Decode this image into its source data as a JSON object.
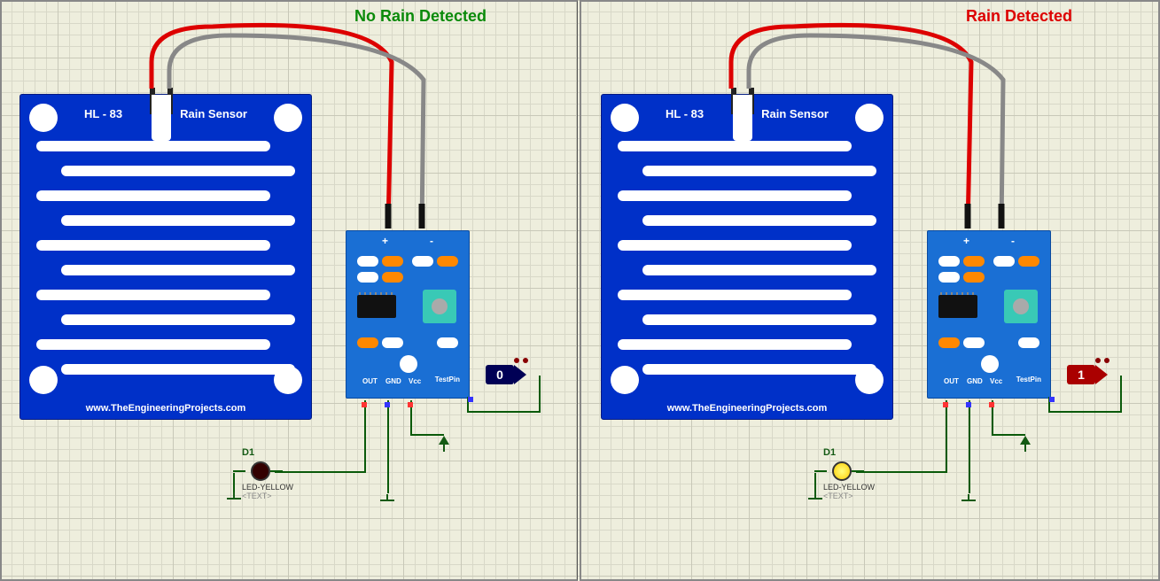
{
  "panels": {
    "left": {
      "status": "No Rain Detected",
      "status_color": "#0a8a0a",
      "probe_value": "0",
      "led_state": "off"
    },
    "right": {
      "status": "Rain Detected",
      "status_color": "#d00000",
      "probe_value": "1",
      "led_state": "on"
    }
  },
  "rain_board": {
    "model": "HL - 83",
    "title": "Rain Sensor",
    "url": "www.TheEngineeringProjects.com"
  },
  "module": {
    "pin_plus": "+",
    "pin_minus": "-",
    "pins": [
      "OUT",
      "GND",
      "Vcc"
    ],
    "test_pin": "TestPin"
  },
  "led": {
    "ref": "D1",
    "part": "LED-YELLOW",
    "text_placeholder": "<TEXT>"
  }
}
